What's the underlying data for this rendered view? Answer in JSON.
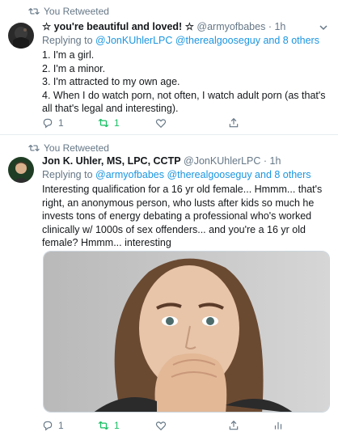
{
  "tweets": [
    {
      "retweeted_label": "You Retweeted",
      "display_name": "☆ you're beautiful and loved! ☆",
      "handle": "@armyofbabes",
      "separator": "·",
      "time": "1h",
      "reply_prefix": "Replying to",
      "reply_to": "@JonKUhlerLPC @therealgooseguy and 8 others",
      "text": "1. I'm a girl.\n2. I'm a minor.\n3. I'm attracted to my own age.\n4. When I do watch porn, not often, I watch adult porn (as that's all that's legal and interesting).",
      "reply_count": "1",
      "retweet_count": "1",
      "avatar_icon": "dark-avatar",
      "has_chevron": true
    },
    {
      "retweeted_label": "You Retweeted",
      "display_name": "Jon K. Uhler, MS, LPC, CCTP",
      "handle": "@JonKUhlerLPC",
      "separator": "·",
      "time": "1h",
      "reply_prefix": "Replying to",
      "reply_to": "@armyofbabes @therealgooseguy and 8 others",
      "text": "Interesting qualification for a 16 yr old female...     Hmmm... that's right, an anonymous person, who lusts after kids so much he invests tons of energy debating a professional who's worked clinically w/ 1000s of sex offenders... and you're a 16 yr old female? Hmmm... interesting",
      "reply_count": "1",
      "retweet_count": "1",
      "avatar_icon": "man-avatar",
      "media_icon": "woman-covering-mouth-photo"
    }
  ],
  "colors": {
    "link": "#1b95e0",
    "secondary_text": "#657786",
    "retweet_green": "#17bf63",
    "border": "#e6ecf0"
  }
}
